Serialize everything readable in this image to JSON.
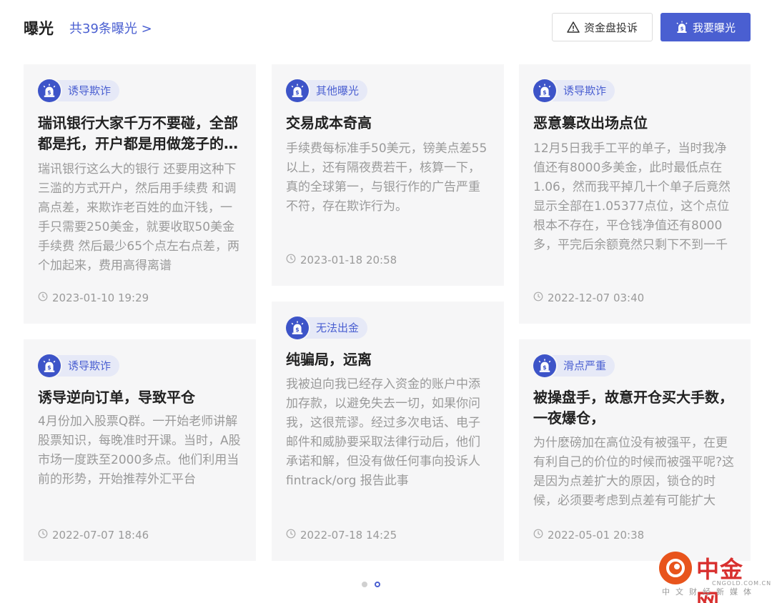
{
  "header": {
    "title": "曝光",
    "count_link": "共39条曝光 >",
    "complaint_button": "资金盘投诉",
    "expose_button": "我要曝光"
  },
  "cards": [
    {
      "tag": "诱导欺诈",
      "title": "瑞讯银行大家千万不要碰，全部都是托，开户都是用做笼子的方式",
      "body": "瑞讯银行这么大的银行 还要用这种下三滥的方式开户，然后用手续费 和调高点差，来欺诈老百姓的血汗钱，一手只需要250美金，就要收取50美金手续费 然后最少65个点左右点差，两个加起来，费用高得离谱",
      "time": "2023-01-10 19:29"
    },
    {
      "tag": "其他曝光",
      "title": "交易成本奇高",
      "body": "手续费每标准手50美元，镑美点差55以上，还有隔夜费若干，核算一下，真的全球第一，与银行作的广告严重不符，存在欺诈行为。",
      "time": "2023-01-18 20:58"
    },
    {
      "tag": "诱导欺诈",
      "title": "恶意篡改出场点位",
      "body": "12月5日我手工平的单子，当时我净值还有8000多美金，此时最低点在1.06，然而我平掉几十个单子后竟然显示全部在1.05377点位，这个点位根本不存在，平仓钱净值还有8000多，平完后余额竟然只剩下不到一千",
      "time": "2022-12-07 03:40"
    },
    {
      "tag": "诱导欺诈",
      "title": "诱导逆向订单，导致平仓",
      "body": "4月份加入股票Q群。一开始老师讲解股票知识，每晚准时开课。当时，A股市场一度跌至2000多点。他们利用当前的形势，开始推荐外汇平台",
      "time": "2022-07-07 18:46"
    },
    {
      "tag": "无法出金",
      "title": "纯骗局，远离",
      "body": "我被迫向我已经存入资金的账户中添加存款，以避免失去一切，如果你问我，这很荒谬。经过多次电话、电子邮件和威胁要采取法律行动后，他们承诺和解，但没有做任何事向投诉人 fintrack/org 报告此事",
      "time": "2022-07-18 14:25"
    },
    {
      "tag": "滑点严重",
      "title": "被操盘手，故意开仓买大手数，一夜爆仓，",
      "body": "为什麽磅加在高位没有被强平，在更有利自己的价位的时候而被强平呢?这是因为点差扩大的原因，锁仓的时候，必须要考虑到点差有可能扩大",
      "time": "2022-05-01 20:38"
    }
  ],
  "pagination": {
    "total_pages": 2,
    "active_page": 2
  },
  "watermark": {
    "brand": "中金网",
    "url": "CNGOLD.COM.CN",
    "subtitle": "中文财经新媒体"
  },
  "colors": {
    "accent": "#4a5fd1",
    "tag_icon_bg": "#3d54c8",
    "tag_bg": "#e6e9f7",
    "card_bg": "#f6f6f7",
    "muted_text": "#9a9a9a",
    "watermark_red": "#d8302f",
    "watermark_orange": "#e8541c"
  },
  "icons": {
    "complaint": "warning-triangle-icon",
    "expose": "alarm-light-icon",
    "tag": "alarm-light-icon",
    "time": "clock-icon"
  }
}
